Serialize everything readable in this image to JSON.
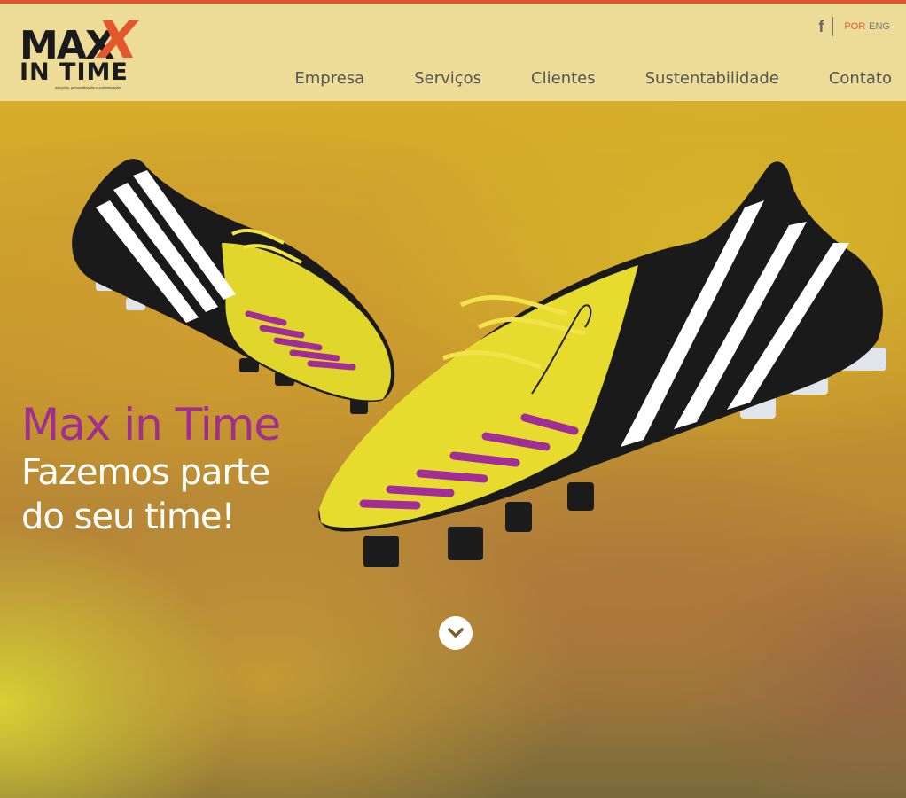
{
  "logo": {
    "line1": "MAX",
    "line2": "IN TIME",
    "tagline": "soluções, personalização e customização",
    "accent_color": "#e4562b"
  },
  "topbar": {
    "social_icon": "facebook-icon",
    "social_glyph": "f",
    "languages": [
      {
        "code": "POR",
        "active": true
      },
      {
        "code": "ENG",
        "active": false
      }
    ]
  },
  "nav": {
    "items": [
      {
        "label": "Empresa"
      },
      {
        "label": "Serviços"
      },
      {
        "label": "Clientes"
      },
      {
        "label": "Sustentabilidade"
      },
      {
        "label": "Contato"
      }
    ]
  },
  "hero": {
    "title": "Max in Time",
    "subtitle": "Fazemos parte do seu time!",
    "scroll_icon": "chevron-down-icon",
    "image": "soccer-cleats-image"
  },
  "colors": {
    "header_bg": "#ecdc97",
    "top_border": "#e0552a",
    "title_purple": "#9e2f8d"
  }
}
